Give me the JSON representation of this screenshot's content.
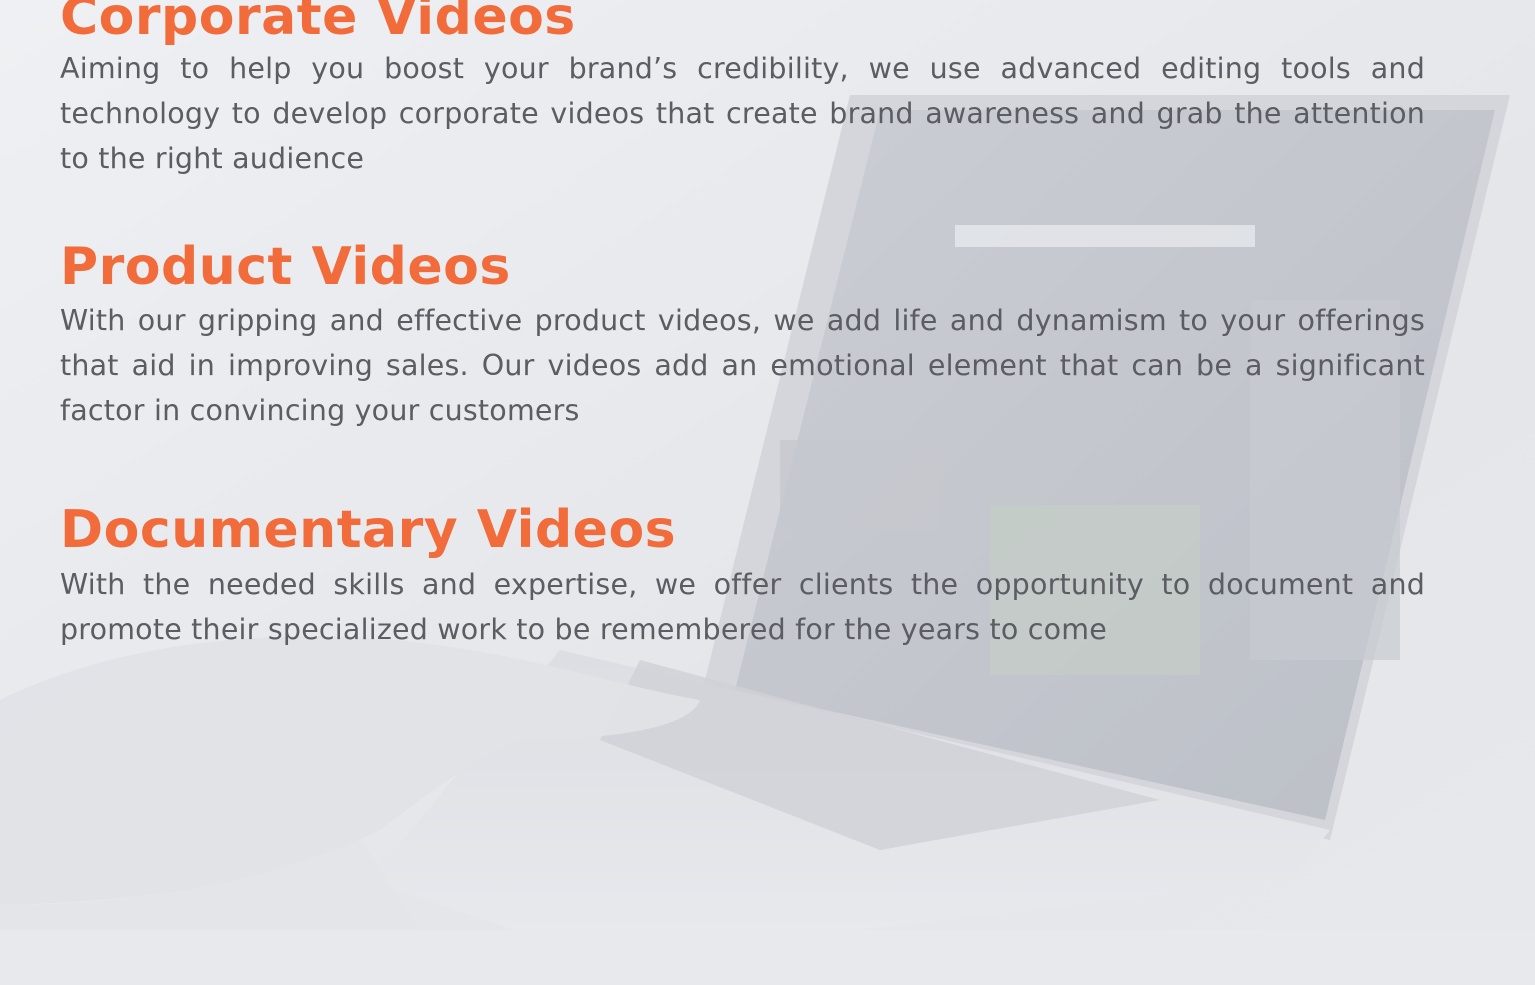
{
  "sections": [
    {
      "title": "Corporate Videos",
      "body": "Aiming to help you boost your brand’s credibility, we use advanced editing tools and technology to develop corporate videos that create brand awareness and grab the attention to the right audience"
    },
    {
      "title": "Product Videos",
      "body": "With our gripping and effective product videos, we add life and dynamism to your of­ferings that aid in improving sales. Our videos add an emotional element that can be a significant factor in convincing your customers"
    },
    {
      "title": "Documentary Videos",
      "body": "With the needed skills and expertise, we offer clients the opportunity to document and promote their specialized work to be remembered for the years to come"
    }
  ],
  "colors": {
    "title": "#f26b3a",
    "body": "#5b5d63",
    "background": "#e9eaee"
  }
}
